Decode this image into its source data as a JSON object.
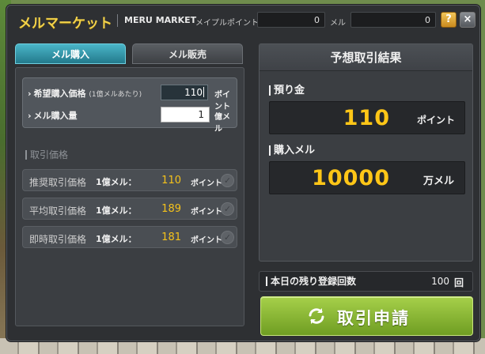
{
  "header": {
    "title_jp": "メルマーケット",
    "title_en": "MERU MARKET",
    "maple_points_label": "メイプルポイント",
    "maple_points_value": "0",
    "meru_label": "メル",
    "meru_value": "0",
    "help_label": "?",
    "close_label": "×"
  },
  "tabs": [
    {
      "label": "メル購入",
      "active": true
    },
    {
      "label": "メル販売",
      "active": false
    }
  ],
  "buy_form": {
    "price_label": "希望購入価格",
    "price_note": "(1億メルあたり)",
    "price_value": "110",
    "price_unit": "ポイント",
    "qty_label": "メル購入量",
    "qty_value": "1",
    "qty_unit": "億メル"
  },
  "trade_prices": {
    "section_title": "取引価格",
    "rows": [
      {
        "label": "推奨取引価格",
        "per": "1億メル：",
        "value": "110",
        "unit": "ポイント"
      },
      {
        "label": "平均取引価格",
        "per": "1億メル：",
        "value": "189",
        "unit": "ポイント"
      },
      {
        "label": "即時取引価格",
        "per": "1億メル：",
        "value": "181",
        "unit": "ポイント"
      }
    ]
  },
  "result": {
    "title": "予想取引結果",
    "deposit_label": "預り金",
    "deposit_value": "110",
    "deposit_unit": "ポイント",
    "purchase_label": "購入メル",
    "purchase_value": "10000",
    "purchase_unit": "万メル"
  },
  "daily_limit": {
    "label": "本日の残り登録回数",
    "value": "100",
    "unit": "回"
  },
  "submit": {
    "label": "取引申請"
  },
  "colors": {
    "accent_gold": "#ffc617",
    "tab_active": "#2f97ab",
    "submit_green": "#8cbf34"
  }
}
